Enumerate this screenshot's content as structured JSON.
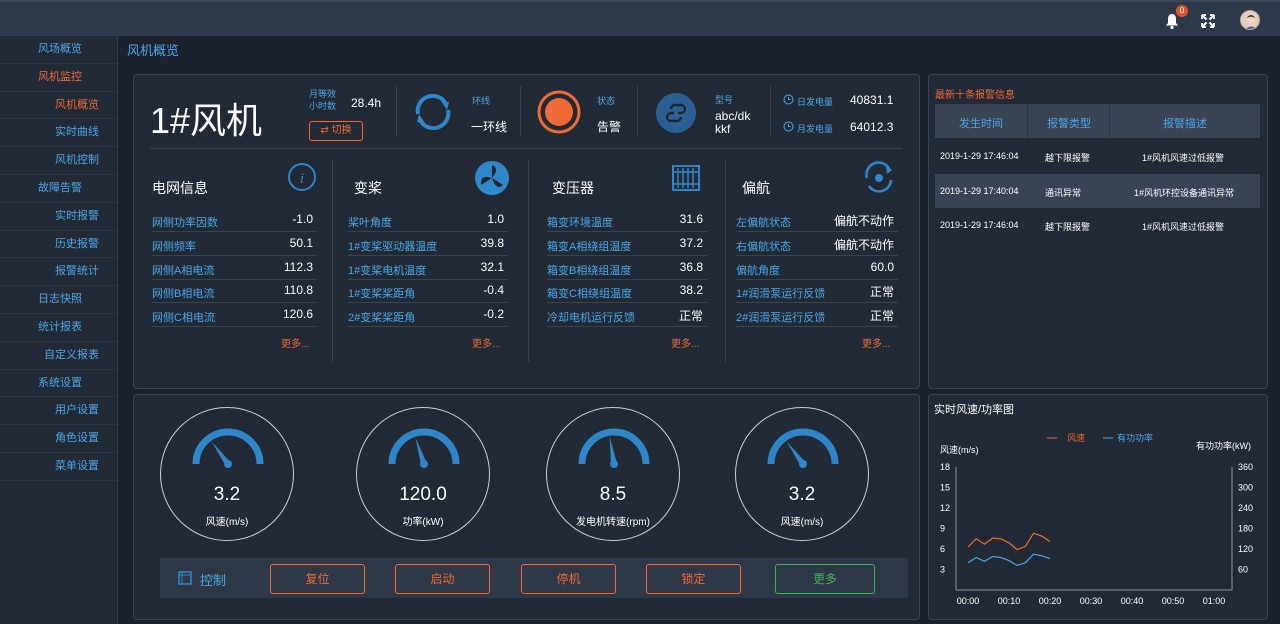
{
  "sidebar": {
    "items": [
      {
        "label": "风场概览",
        "level": 1,
        "active": false
      },
      {
        "label": "风机监控",
        "level": 1,
        "active": true
      },
      {
        "label": "风机概览",
        "level": 2,
        "active": true
      },
      {
        "label": "实时曲线",
        "level": 2,
        "active": false
      },
      {
        "label": "风机控制",
        "level": 2,
        "active": false
      },
      {
        "label": "故障告警",
        "level": 1,
        "active": false
      },
      {
        "label": "实时报警",
        "level": 2,
        "active": false
      },
      {
        "label": "历史报警",
        "level": 2,
        "active": false
      },
      {
        "label": "报警统计",
        "level": 2,
        "active": false
      },
      {
        "label": "日志快照",
        "level": 1,
        "active": false
      },
      {
        "label": "统计报表",
        "level": 1,
        "active": false
      },
      {
        "label": "自定义报表",
        "level": 2,
        "active": false
      },
      {
        "label": "系统设置",
        "level": 1,
        "active": false
      },
      {
        "label": "用户设置",
        "level": 2,
        "active": false
      },
      {
        "label": "角色设置",
        "level": 2,
        "active": false
      },
      {
        "label": "菜单设置",
        "level": 2,
        "active": false
      }
    ]
  },
  "header": {
    "notification_count": "0"
  },
  "breadcrumb": "风机概览",
  "turbine": {
    "name": "1#风机",
    "equiv_hours_label_1": "月等效",
    "equiv_hours_label_2": "小时数",
    "equiv_hours_value": "28.4h",
    "switch_label": "切换",
    "ring_label": "环线",
    "ring_value": "一环线",
    "status_label": "状态",
    "status_value": "告警",
    "model_label": "型号",
    "model_value_1": "abc/dk",
    "model_value_2": "kkf",
    "day_power_label": "日发电量",
    "day_power_value": "40831.1",
    "month_power_label": "月发电量",
    "month_power_value": "64012.3"
  },
  "sections": [
    {
      "title": "电网信息",
      "rows": [
        {
          "k": "网侧功率因数",
          "v": "-1.0"
        },
        {
          "k": "网侧频率",
          "v": "50.1"
        },
        {
          "k": "网侧A相电流",
          "v": "112.3"
        },
        {
          "k": "网侧B相电流",
          "v": "110.8"
        },
        {
          "k": "网侧C相电流",
          "v": "120.6"
        }
      ],
      "more": "更多..."
    },
    {
      "title": "变桨",
      "rows": [
        {
          "k": "桨叶角度",
          "v": "1.0"
        },
        {
          "k": "1#变桨驱动器温度",
          "v": "39.8"
        },
        {
          "k": "1#变桨电机温度",
          "v": "32.1"
        },
        {
          "k": "1#变桨桨距角",
          "v": "-0.4"
        },
        {
          "k": "2#变桨桨距角",
          "v": "-0.2"
        }
      ],
      "more": "更多..."
    },
    {
      "title": "变压器",
      "rows": [
        {
          "k": "箱变环境温度",
          "v": "31.6"
        },
        {
          "k": "箱变A相绕组温度",
          "v": "37.2"
        },
        {
          "k": "箱变B相绕组温度",
          "v": "36.8"
        },
        {
          "k": "箱变C相绕组温度",
          "v": "38.2"
        },
        {
          "k": "冷却电机运行反馈",
          "v": "正常"
        }
      ],
      "more": "更多..."
    },
    {
      "title": "偏航",
      "rows": [
        {
          "k": "左偏航状态",
          "v": "偏航不动作"
        },
        {
          "k": "右偏航状态",
          "v": "偏航不动作"
        },
        {
          "k": "偏航角度",
          "v": "60.0"
        },
        {
          "k": "1#润滑泵运行反馈",
          "v": "正常"
        },
        {
          "k": "2#润滑泵运行反馈",
          "v": "正常"
        }
      ],
      "more": "更多..."
    }
  ],
  "gauges": [
    {
      "value": "3.2",
      "label": "风速(m/s)",
      "level": 0.3
    },
    {
      "value": "120.0",
      "label": "功率(kW)",
      "level": 0.4
    },
    {
      "value": "8.5",
      "label": "发电机转速(rpm)",
      "level": 0.45
    },
    {
      "value": "3.2",
      "label": "风速(m/s)",
      "level": 0.3
    }
  ],
  "controls": {
    "label": "控制",
    "buttons": [
      "复位",
      "启动",
      "停机",
      "锁定",
      "更多"
    ]
  },
  "alarms": {
    "title": "最新十条报警信息",
    "columns": [
      "发生时间",
      "报警类型",
      "报警描述"
    ],
    "rows": [
      {
        "time": "2019-1-29 17:46:04",
        "type": "越下限报警",
        "desc": "1#风机风速过低报警"
      },
      {
        "time": "2019-1-29 17:40:04",
        "type": "通讯异常",
        "desc": "1#风机环控设备通讯异常"
      },
      {
        "time": "2019-1-29 17:46:04",
        "type": "越下限报警",
        "desc": "1#风机风速过低报警"
      }
    ]
  },
  "chart_data": {
    "type": "line",
    "title": "实时风速/功率图",
    "ylabel": "风速(m/s)",
    "y2label": "有功功率(kW)",
    "x_ticks": [
      "00:00",
      "00:10",
      "00:20",
      "00:30",
      "00:40",
      "00:50",
      "01:00"
    ],
    "y_ticks": [
      "18",
      "15",
      "12",
      "9",
      "6",
      "3"
    ],
    "y2_ticks": [
      "360",
      "300",
      "240",
      "180",
      "120",
      "60"
    ],
    "ylim": [
      0,
      18
    ],
    "y2lim": [
      0,
      360
    ],
    "series": [
      {
        "name": "风速",
        "color": "#ee6a36",
        "axis": "left",
        "x": [
          0,
          2,
          4,
          6,
          8,
          10,
          12,
          14,
          16,
          18,
          20
        ],
        "y": [
          6.3,
          7.5,
          6.7,
          7.6,
          7.5,
          6.9,
          5.9,
          6.4,
          8.3,
          7.9,
          7.1
        ]
      },
      {
        "name": "有功功率",
        "color": "#4aa6e8",
        "axis": "right",
        "x": [
          0,
          2,
          4,
          6,
          8,
          10,
          12,
          14,
          16,
          18,
          20
        ],
        "y": [
          80,
          95,
          84,
          98,
          95,
          86,
          72,
          80,
          105,
          100,
          92
        ]
      }
    ]
  }
}
